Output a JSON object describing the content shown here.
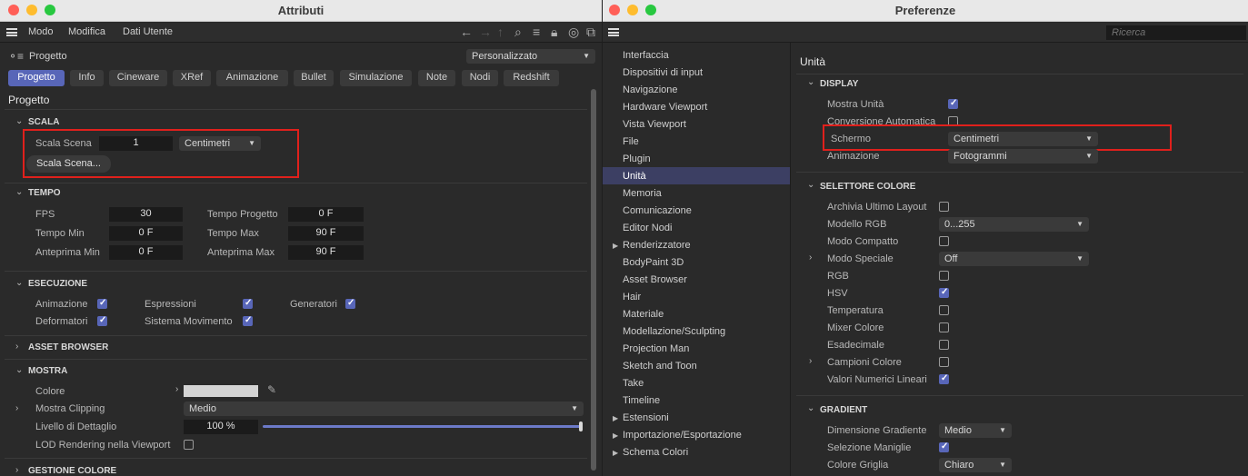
{
  "attr": {
    "title": "Attributi",
    "menu": [
      "Modo",
      "Modifica",
      "Dati Utente"
    ],
    "object_label": "Progetto",
    "layout_dropdown": "Personalizzato",
    "tabs": [
      "Progetto",
      "Info",
      "Cineware",
      "XRef",
      "Animazione",
      "Bullet",
      "Simulazione",
      "Note",
      "Nodi",
      "Redshift"
    ],
    "page_title": "Progetto",
    "scala": {
      "header": "SCALA",
      "scene_label": "Scala Scena",
      "scene_value": "1",
      "unit": "Centimetri",
      "button": "Scala Scena..."
    },
    "tempo": {
      "header": "TEMPO",
      "fps_label": "FPS",
      "fps_value": "30",
      "tempo_progetto_label": "Tempo Progetto",
      "tempo_progetto_value": "0 F",
      "tempo_min_label": "Tempo Min",
      "tempo_min_value": "0 F",
      "tempo_max_label": "Tempo Max",
      "tempo_max_value": "90 F",
      "anteprima_min_label": "Anteprima Min",
      "anteprima_min_value": "0 F",
      "anteprima_max_label": "Anteprima Max",
      "anteprima_max_value": "90 F"
    },
    "esecuzione": {
      "header": "ESECUZIONE",
      "animazione": "Animazione",
      "espressioni": "Espressioni",
      "generatori": "Generatori",
      "deformatori": "Deformatori",
      "sistema_movimento": "Sistema Movimento"
    },
    "asset_browser_header": "ASSET BROWSER",
    "mostra": {
      "header": "MOSTRA",
      "colore_label": "Colore",
      "clipping_label": "Mostra Clipping",
      "clipping_value": "Medio",
      "dettaglio_label": "Livello di Dettaglio",
      "dettaglio_value": "100 %",
      "dettaglio_fraction": 1.0,
      "lod_label": "LOD Rendering nella Viewport"
    },
    "gestione_colore_header": "GESTIONE COLORE"
  },
  "pref": {
    "title": "Preferenze",
    "search_placeholder": "Ricerca",
    "sidebar": [
      {
        "label": "Interfaccia"
      },
      {
        "label": "Dispositivi di input"
      },
      {
        "label": "Navigazione"
      },
      {
        "label": "Hardware Viewport"
      },
      {
        "label": "Vista Viewport"
      },
      {
        "label": "File"
      },
      {
        "label": "Plugin"
      },
      {
        "label": "Unità"
      },
      {
        "label": "Memoria"
      },
      {
        "label": "Comunicazione"
      },
      {
        "label": "Editor Nodi"
      },
      {
        "label": "Renderizzatore"
      },
      {
        "label": "BodyPaint 3D"
      },
      {
        "label": "Asset Browser"
      },
      {
        "label": "Hair"
      },
      {
        "label": "Materiale"
      },
      {
        "label": "Modellazione/Sculpting"
      },
      {
        "label": "Projection Man"
      },
      {
        "label": "Sketch and Toon"
      },
      {
        "label": "Take"
      },
      {
        "label": "Timeline"
      },
      {
        "label": "Estensioni"
      },
      {
        "label": "Importazione/Esportazione"
      },
      {
        "label": "Schema Colori"
      }
    ],
    "page_title": "Unità",
    "display": {
      "header": "DISPLAY",
      "mostra_unita": "Mostra Unità",
      "conversione": "Conversione Automatica",
      "schermo_label": "Schermo",
      "schermo_value": "Centimetri",
      "animazione_label": "Animazione",
      "animazione_value": "Fotogrammi"
    },
    "selettore": {
      "header": "SELETTORE COLORE",
      "archivia": "Archivia Ultimo Layout",
      "modello_rgb": "Modello RGB",
      "modello_rgb_value": "0...255",
      "modo_compatto": "Modo Compatto",
      "modo_speciale": "Modo Speciale",
      "modo_speciale_value": "Off",
      "rgb": "RGB",
      "hsv": "HSV",
      "temperatura": "Temperatura",
      "mixer": "Mixer Colore",
      "esadecimale": "Esadecimale",
      "campioni": "Campioni Colore",
      "valori_lineari": "Valori Numerici Lineari"
    },
    "gradient": {
      "header": "GRADIENT",
      "dimensione": "Dimensione Gradiente",
      "dimensione_value": "Medio",
      "selezione": "Selezione Maniglie",
      "griglia": "Colore Griglia",
      "griglia_value": "Chiaro"
    }
  }
}
